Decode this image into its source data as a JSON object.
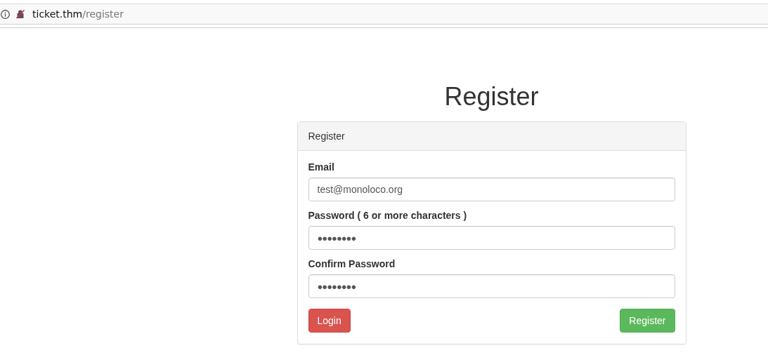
{
  "address_bar": {
    "host": "ticket.thm",
    "path": "/register"
  },
  "page_title": "Register",
  "panel": {
    "heading": "Register",
    "fields": [
      {
        "label": "Email",
        "value": "test@monoloco.org",
        "kind": "text"
      },
      {
        "label": "Password ( 6 or more characters )",
        "value": "●●●●●●●●",
        "kind": "password"
      },
      {
        "label": "Confirm Password",
        "value": "●●●●●●●●",
        "kind": "password"
      }
    ],
    "buttons": [
      {
        "label": "Login",
        "kind": "danger"
      },
      {
        "label": "Register",
        "kind": "success"
      }
    ]
  }
}
